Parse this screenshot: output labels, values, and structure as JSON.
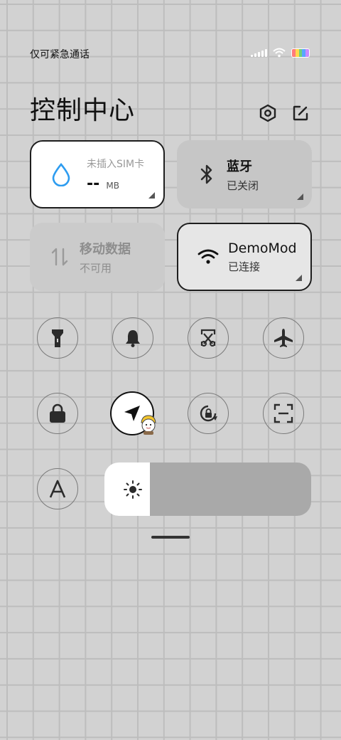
{
  "status": {
    "carrier_text": "仅可紧急通话"
  },
  "header": {
    "title": "控制中心"
  },
  "tiles": {
    "data_usage": {
      "label": "未插入SIM卡",
      "value": "--",
      "unit": "MB"
    },
    "bluetooth": {
      "label": "蓝牙",
      "status": "已关闭"
    },
    "mobile_data": {
      "label": "移动数据",
      "status": "不可用"
    },
    "wifi": {
      "label": "DemoMod",
      "status": "已连接"
    }
  },
  "toggles": [
    {
      "name": "flashlight"
    },
    {
      "name": "mute"
    },
    {
      "name": "screenshot"
    },
    {
      "name": "airplane-mode"
    },
    {
      "name": "lock-screen"
    },
    {
      "name": "location",
      "state": "on"
    },
    {
      "name": "auto-rotate"
    },
    {
      "name": "scanner"
    },
    {
      "name": "reading-mode"
    }
  ],
  "brightness": {
    "level": 0.22
  },
  "colors": {
    "accent_blue": "#2d9cf0",
    "icon_dark": "#2b2b2b",
    "battery": [
      "#ff6b6b",
      "#ffd93d",
      "#6bcB77",
      "#4d96ff",
      "#c77dff"
    ]
  }
}
